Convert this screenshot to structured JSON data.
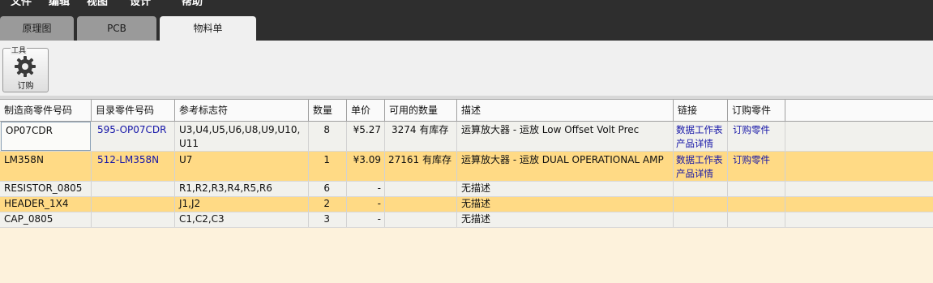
{
  "menubar": {
    "items": [
      "文件",
      "编辑",
      "视图",
      "设计",
      "帮助"
    ]
  },
  "tabs": [
    {
      "label": "原理图",
      "active": false
    },
    {
      "label": "PCB",
      "active": false
    },
    {
      "label": "物料单",
      "active": true
    }
  ],
  "toolbar": {
    "group_label": "工具",
    "order_button": {
      "label": "订购",
      "icon": "gear-icon"
    }
  },
  "table": {
    "columns": [
      "制造商零件号码",
      "目录零件号码",
      "参考标志符",
      "数量",
      "单价",
      "可用的数量",
      "描述",
      "链接",
      "订购零件"
    ],
    "rows": [
      {
        "mfr_part": "OP07CDR",
        "catalog_part": "595-OP07CDR",
        "designators": "U3,U4,U5,U6,U8,U9,U10,\nU11",
        "qty": "8",
        "price": "¥5.27",
        "available": "3274 有库存",
        "description": "运算放大器 - 运放 Low Offset Volt Prec",
        "link1": "数据工作表",
        "link2": "产品详情",
        "order": "订购零件"
      },
      {
        "mfr_part": "LM358N",
        "catalog_part": "512-LM358N",
        "designators": "U7",
        "qty": "1",
        "price": "¥3.09",
        "available": "27161 有库存",
        "description": "运算放大器 - 运放 DUAL OPERATIONAL AMP",
        "link1": "数据工作表",
        "link2": "产品详情",
        "order": "订购零件"
      },
      {
        "mfr_part": "RESISTOR_0805",
        "catalog_part": "",
        "designators": "R1,R2,R3,R4,R5,R6",
        "qty": "6",
        "price": "-",
        "available": "",
        "description": "无描述",
        "link1": "",
        "link2": "",
        "order": ""
      },
      {
        "mfr_part": "HEADER_1X4",
        "catalog_part": "",
        "designators": "J1,J2",
        "qty": "2",
        "price": "-",
        "available": "",
        "description": "无描述",
        "link1": "",
        "link2": "",
        "order": ""
      },
      {
        "mfr_part": "CAP_0805",
        "catalog_part": "",
        "designators": "C1,C2,C3",
        "qty": "3",
        "price": "-",
        "available": "",
        "description": "无描述",
        "link1": "",
        "link2": "",
        "order": ""
      }
    ]
  }
}
